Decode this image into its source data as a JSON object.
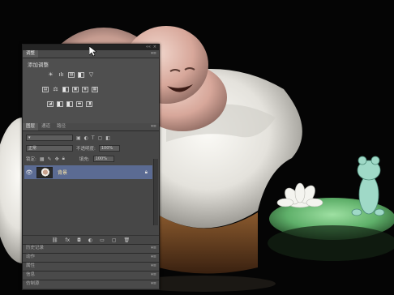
{
  "panels": {
    "adjustments": {
      "tab_label": "调整",
      "title": "添加调整",
      "menu_icon": "panel-menu-icon",
      "row1": [
        {
          "icon": "brightness-icon",
          "glyph": "☀"
        },
        {
          "icon": "levels-icon",
          "glyph": "ıIı"
        },
        {
          "icon": "curves-icon",
          "glyph": "▨"
        },
        {
          "icon": "exposure-icon",
          "glyph": "◩"
        },
        {
          "icon": "gradient-map-triangle-icon",
          "glyph": "▽"
        }
      ],
      "row2": [
        {
          "icon": "vibrance-icon",
          "glyph": "▤"
        },
        {
          "icon": "balance-icon",
          "glyph": "⚖"
        },
        {
          "icon": "black-white-icon",
          "glyph": "◧"
        },
        {
          "icon": "photo-filter-icon",
          "glyph": "▣"
        },
        {
          "icon": "mixer-icon",
          "glyph": "◈"
        },
        {
          "icon": "lookup-icon",
          "glyph": "▦"
        }
      ],
      "row3": [
        {
          "icon": "invert-icon",
          "glyph": "◪"
        },
        {
          "icon": "posterize-icon",
          "glyph": "▧"
        },
        {
          "icon": "threshold-icon",
          "glyph": "◩"
        },
        {
          "icon": "gradient-map-icon",
          "glyph": "▬"
        },
        {
          "icon": "selective-color-icon",
          "glyph": "◨"
        }
      ]
    },
    "layers": {
      "tabs": [
        "图层",
        "通道",
        "路径"
      ],
      "blend_mode": "正常",
      "opacity_label": "不透明度:",
      "opacity_value": "100%",
      "lock_label": "锁定:",
      "fill_label": "填充:",
      "fill_value": "100%",
      "layer": {
        "name": "背景",
        "visible": true,
        "locked": true
      },
      "footer_icons": [
        "link-icon",
        "fx-icon",
        "mask-icon",
        "adjustment-layer-icon",
        "group-icon",
        "new-layer-icon",
        "delete-icon"
      ]
    },
    "collapsed": [
      "历史记录",
      "动作",
      "属性",
      "信息",
      "仿制源"
    ]
  }
}
